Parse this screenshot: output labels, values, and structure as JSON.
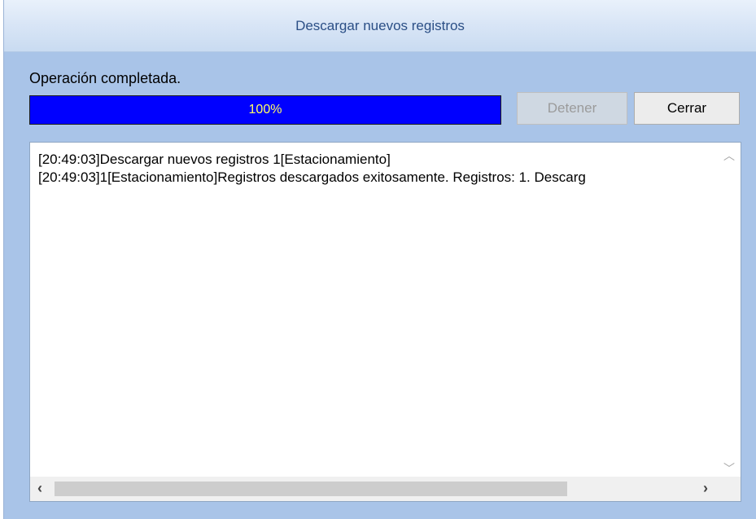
{
  "window": {
    "title": "Descargar nuevos registros"
  },
  "status": {
    "text": "Operación completada."
  },
  "progress": {
    "value_percent": 100,
    "label": "100%",
    "fill_color": "#0000ff",
    "text_color": "#ffff66"
  },
  "buttons": {
    "stop_label": "Detener",
    "stop_enabled": false,
    "close_label": "Cerrar"
  },
  "log": {
    "lines": [
      "[20:49:03]Descargar nuevos registros 1[Estacionamiento]",
      "[20:49:03]1[Estacionamiento]Registros descargados exitosamente. Registros: 1. Descarg"
    ]
  },
  "scrollbars": {
    "up_icon": "chevron-up-icon",
    "down_icon": "chevron-down-icon",
    "left_icon": "chevron-left-icon",
    "right_icon": "chevron-right-icon"
  }
}
